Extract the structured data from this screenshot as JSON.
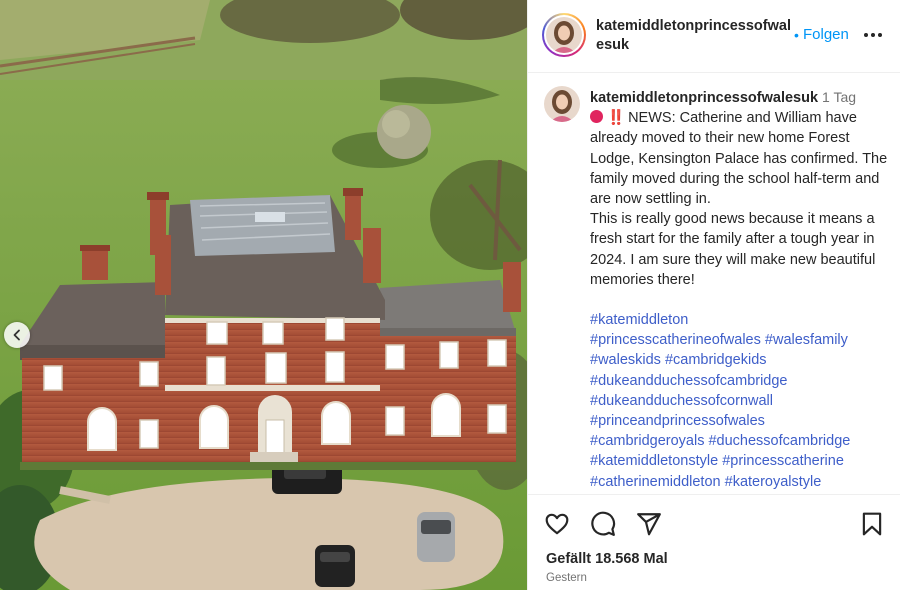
{
  "header": {
    "username": "katemiddletonprincessofwalesuk",
    "follow_label": "Folgen",
    "dot": "•"
  },
  "caption": {
    "username": "katemiddletonprincessofwalesuk",
    "time": "1 Tag",
    "emoji_marks": "‼️",
    "paragraph1": "NEWS: Catherine and William have already moved to their new home Forest Lodge, Kensington Palace has confirmed. The family moved during the school half-term and are now settling in.",
    "paragraph2": "This is really good news because it means a fresh start for the family after a tough year in 2024. I am sure they will make new beautiful memories there!",
    "hashtags": [
      "#katemiddleton",
      "#princesscatherineofwales",
      "#walesfamily",
      "#waleskids",
      "#cambridgekids",
      "#dukeandduchessofcambridge",
      "#dukeandduchessofcornwall",
      "#princeandprincessofwales",
      "#cambridgeroyals",
      "#duchessofcambridge",
      "#katemiddletonstyle",
      "#princesscatherine",
      "#catherinemiddleton",
      "#kateroyalstyle"
    ]
  },
  "actions": {
    "likes": "Gefällt 18.568 Mal",
    "date": "Gestern",
    "icons": [
      "heart-icon",
      "comment-icon",
      "share-icon",
      "bookmark-icon"
    ]
  },
  "photo": {
    "alt_description_icon": "carousel-previous-icon"
  },
  "colors": {
    "link": "#3e5ec9",
    "follow": "#0095f6",
    "text": "#262626",
    "muted": "#737373"
  }
}
